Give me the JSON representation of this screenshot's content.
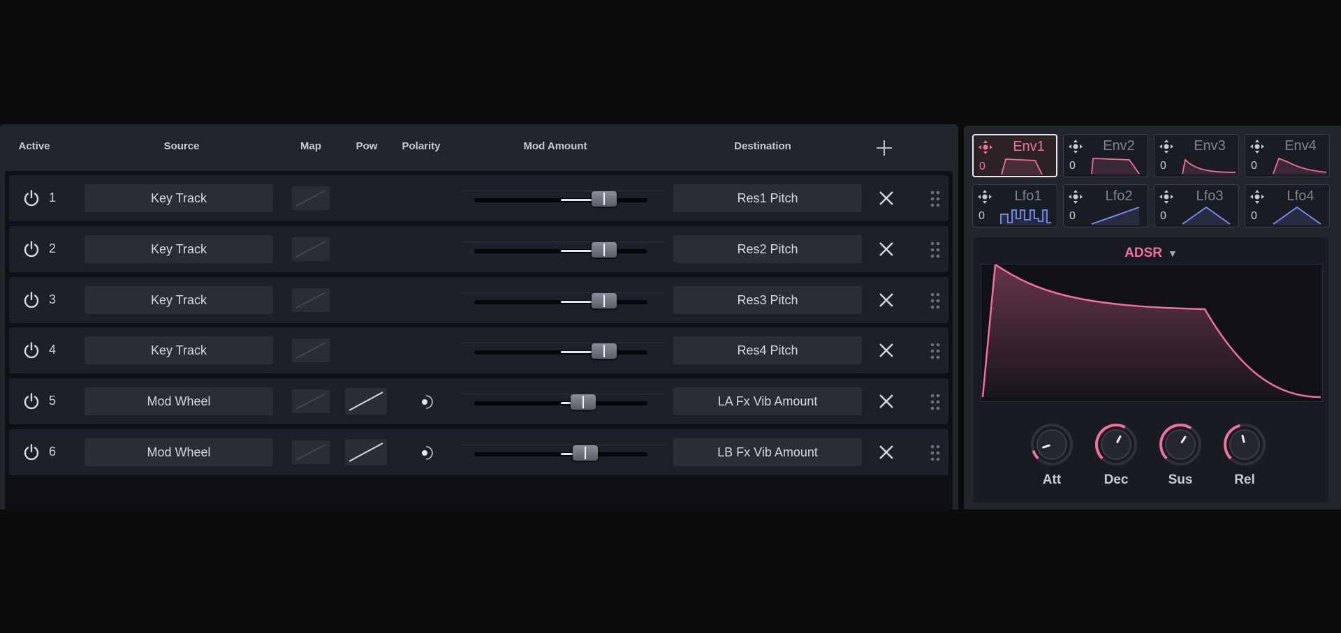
{
  "header": {
    "active": "Active",
    "source": "Source",
    "map": "Map",
    "pow": "Pow",
    "polarity": "Polarity",
    "mod_amount": "Mod Amount",
    "destination": "Destination"
  },
  "rows": [
    {
      "num": "1",
      "source": "Key Track",
      "destination": "Res1 Pitch",
      "amount": 0.75,
      "has_pow": false
    },
    {
      "num": "2",
      "source": "Key Track",
      "destination": "Res2 Pitch",
      "amount": 0.75,
      "has_pow": false
    },
    {
      "num": "3",
      "source": "Key Track",
      "destination": "Res3 Pitch",
      "amount": 0.75,
      "has_pow": false
    },
    {
      "num": "4",
      "source": "Key Track",
      "destination": "Res4 Pitch",
      "amount": 0.75,
      "has_pow": false
    },
    {
      "num": "5",
      "source": "Mod Wheel",
      "destination": "LA Fx Vib Amount",
      "amount": 0.63,
      "has_pow": true
    },
    {
      "num": "6",
      "source": "Mod Wheel",
      "destination": "LB Fx Vib Amount",
      "amount": 0.64,
      "has_pow": true
    }
  ],
  "sources": [
    {
      "name": "Env1",
      "value": "0",
      "selected": true
    },
    {
      "name": "Env2",
      "value": "0",
      "selected": false
    },
    {
      "name": "Env3",
      "value": "0",
      "selected": false
    },
    {
      "name": "Env4",
      "value": "0",
      "selected": false
    },
    {
      "name": "Lfo1",
      "value": "0",
      "selected": false
    },
    {
      "name": "Lfo2",
      "value": "0",
      "selected": false
    },
    {
      "name": "Lfo3",
      "value": "0",
      "selected": false
    },
    {
      "name": "Lfo4",
      "value": "0",
      "selected": false
    }
  ],
  "editor": {
    "title": "ADSR",
    "caret": "▼",
    "knobs": [
      {
        "label": "Att",
        "value": 0.1
      },
      {
        "label": "Dec",
        "value": 0.6
      },
      {
        "label": "Sus",
        "value": 0.62
      },
      {
        "label": "Rel",
        "value": 0.45
      }
    ]
  },
  "colors": {
    "accent": "#f2709b",
    "lfo": "#7b8ff5",
    "panel": "#23252d"
  }
}
